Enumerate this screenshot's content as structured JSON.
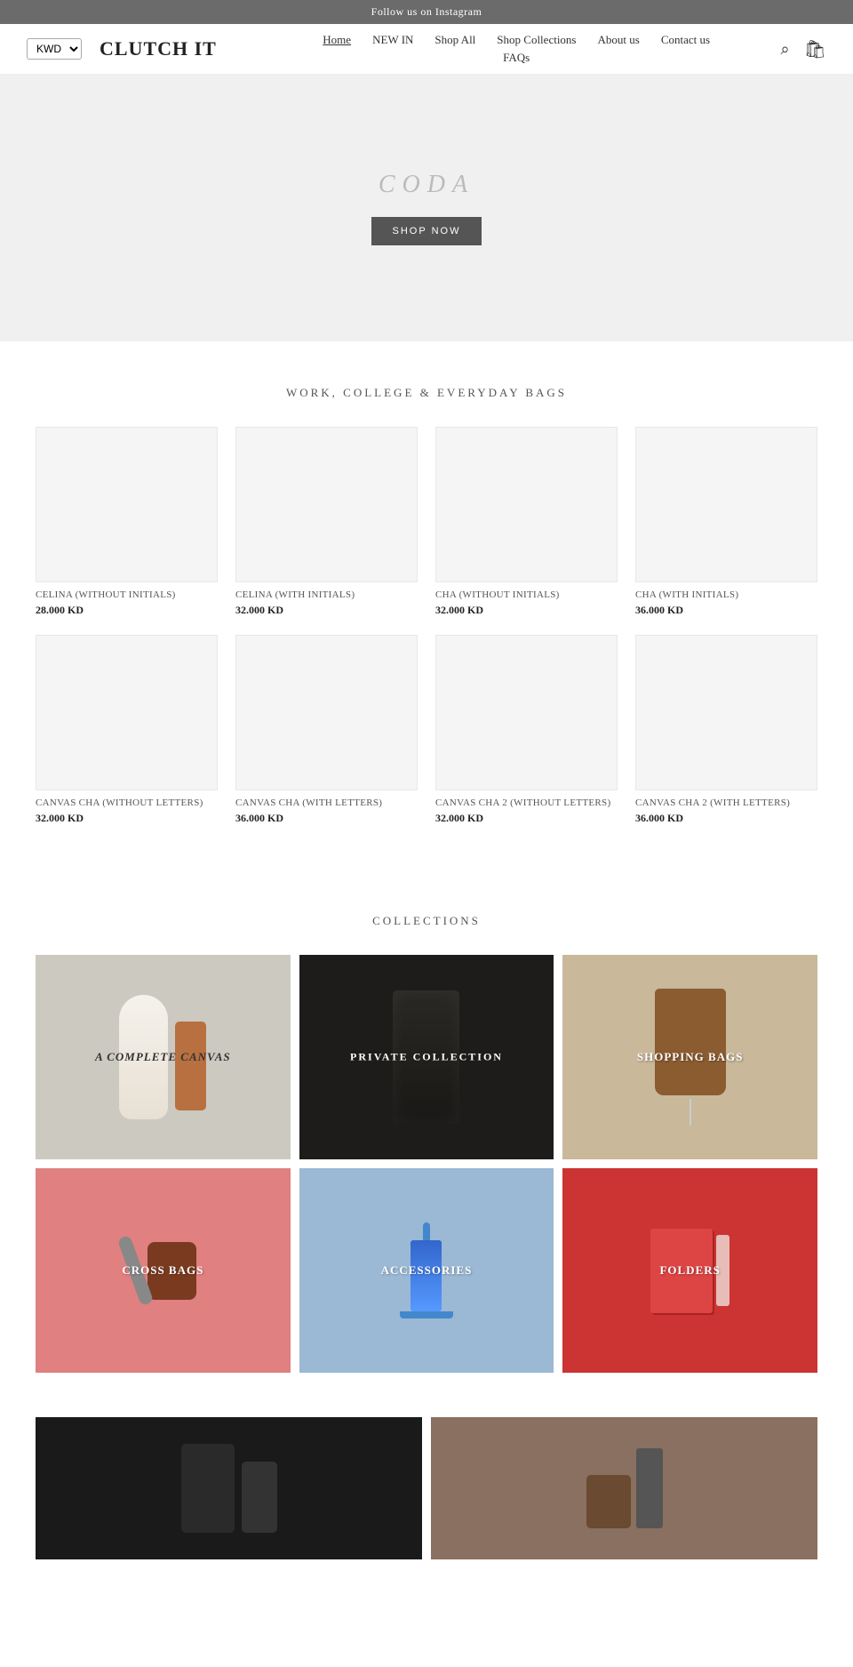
{
  "topbar": {
    "text": "Follow us on Instagram"
  },
  "header": {
    "currency": "KWD",
    "logo": "CLUTCH IT",
    "nav": {
      "links": [
        {
          "label": "Home",
          "active": true
        },
        {
          "label": "NEW IN",
          "active": false
        },
        {
          "label": "Shop All",
          "active": false
        },
        {
          "label": "Shop Collections",
          "active": false
        },
        {
          "label": "About us",
          "active": false
        },
        {
          "label": "Contact us",
          "active": false
        }
      ],
      "second_row": [
        {
          "label": "FAQs"
        }
      ]
    }
  },
  "hero": {
    "title": "CODA",
    "cta": "SHOP NOW"
  },
  "products_section": {
    "title": "WORK, COLLEGE & EVERYDAY BAGS",
    "products": [
      {
        "name": "CELINA (without initials)",
        "price": "28.000 KD"
      },
      {
        "name": "CELINA (with initials)",
        "price": "32.000 KD"
      },
      {
        "name": "CHA (without initials)",
        "price": "32.000 KD"
      },
      {
        "name": "CHA (with initials)",
        "price": "36.000 KD"
      },
      {
        "name": "CANVAS CHA (without letters)",
        "price": "32.000 KD"
      },
      {
        "name": "CANVAS CHA (with letters)",
        "price": "36.000 KD"
      },
      {
        "name": "CANVAS CHA 2 (without letters)",
        "price": "32.000 KD"
      },
      {
        "name": "CANVAS CHA 2 (with letters)",
        "price": "36.000 KD"
      }
    ]
  },
  "collections_section": {
    "title": "COLLECTIONS",
    "collections": [
      {
        "label": "A Complete Canvas",
        "bg": "canvas"
      },
      {
        "label": "PRIVATE COLLECTION",
        "bg": "private"
      },
      {
        "label": "Shopping Bags",
        "bg": "shopping"
      },
      {
        "label": "Cross Bags",
        "bg": "cross"
      },
      {
        "label": "Accessories",
        "bg": "accessories"
      },
      {
        "label": "Folders",
        "bg": "folders"
      }
    ]
  },
  "colors": {
    "canvas_bg": "#ccc9c0",
    "private_bg": "#2a2826",
    "shopping_bg": "#b8a898",
    "cross_bg": "#e08888",
    "accessories_bg": "#93b4cc",
    "folders_bg": "#c83333"
  }
}
